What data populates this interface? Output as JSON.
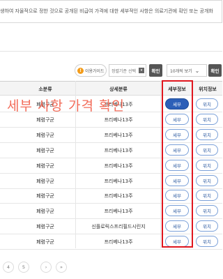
{
  "notice": {
    "text": "생하여 자율적으로 정한 것으로 공개된 비급여 가격에 대한 세부적인 사항은 의료기관에 확인 또는 공개화"
  },
  "toolbar": {
    "guide_label": "이용가이드",
    "guide_icon": "!",
    "sort_placeholder": "정렬기준 선택",
    "confirm_label": "확인",
    "count_value": "10개씩 보기",
    "confirm2_label": "확인"
  },
  "table": {
    "headers": [
      "소분류",
      "상세분류",
      "세부정보",
      "위치정보"
    ],
    "rows": [
      {
        "sub": "폐렴구균",
        "detail": "프리베나13주",
        "detail_btn": "세부",
        "loc_btn": "위치"
      },
      {
        "sub": "폐렴구균",
        "detail": "프리베나13주",
        "detail_btn": "세부",
        "loc_btn": "위치"
      },
      {
        "sub": "폐렴구균",
        "detail": "프리베나13주",
        "detail_btn": "세부",
        "loc_btn": "위치"
      },
      {
        "sub": "폐렴구균",
        "detail": "프리베나13주",
        "detail_btn": "세부",
        "loc_btn": "위치"
      },
      {
        "sub": "폐렴구균",
        "detail": "프리베나13주",
        "detail_btn": "세부",
        "loc_btn": "위치"
      },
      {
        "sub": "폐렴구균",
        "detail": "프리베나13주",
        "detail_btn": "세부",
        "loc_btn": "위치"
      },
      {
        "sub": "폐렴구균",
        "detail": "프리베나13주",
        "detail_btn": "세부",
        "loc_btn": "위치"
      },
      {
        "sub": "폐렴구균",
        "detail": "프리베나13주",
        "detail_btn": "세부",
        "loc_btn": "위치"
      },
      {
        "sub": "폐렴구균",
        "detail": "신플로릭스프리필드시린지",
        "detail_btn": "세부",
        "loc_btn": "위치"
      },
      {
        "sub": "폐렴구균",
        "detail": "프리베나13주",
        "detail_btn": "세부",
        "loc_btn": "위치"
      }
    ]
  },
  "annotation": {
    "overlay_text": "세부 사항 가격 확인",
    "highlight_color": "#e0161e"
  },
  "pagination": {
    "pages": [
      "4",
      "5"
    ],
    "next": "›",
    "last": "»"
  }
}
